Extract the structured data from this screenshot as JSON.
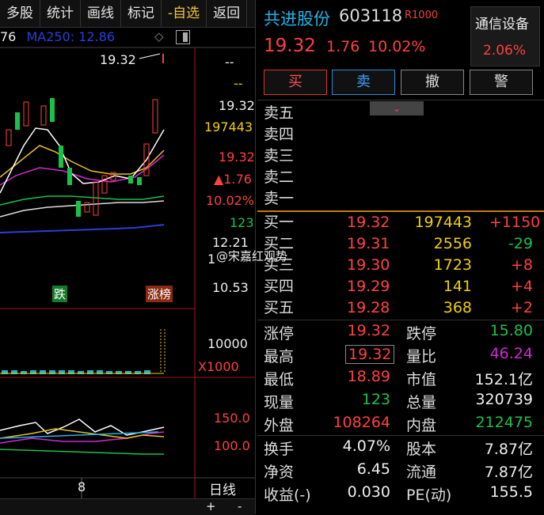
{
  "toolbar": {
    "items": [
      "多股",
      "统计",
      "画线",
      "标记",
      "-自选",
      "返回"
    ]
  },
  "chart": {
    "ma_prefix": "76",
    "ma250_label": "MA250: 12.86",
    "high_marker": "19.32",
    "price_axis": [
      "--",
      "--",
      "19.32",
      "197443",
      "19.32",
      "▲1.76",
      "10.02%",
      "123",
      "12.21",
      "1",
      "10.53"
    ],
    "tag_die": "跌",
    "tag_zhangbang": "涨榜",
    "vol_axis": [
      "10000",
      "X1000"
    ],
    "ind_axis": [
      "150.0",
      "100.0"
    ],
    "x_label": "8",
    "period": "日线",
    "plus": "+",
    "minus": "-"
  },
  "header": {
    "name": "共进股份",
    "code": "603118",
    "badge": "R1000",
    "last": "19.32",
    "change": "1.76",
    "change_pct": "10.02%",
    "industry": "通信设备",
    "industry_pct": "2.06%"
  },
  "actions": {
    "buy": "买",
    "sell": "卖",
    "cancel": "撤",
    "alert": "警"
  },
  "orderbook": {
    "asks": [
      "卖五",
      "卖四",
      "卖三",
      "卖二",
      "卖一"
    ],
    "bids": [
      {
        "label": "买一",
        "price": "19.32",
        "vol": "197443",
        "diff": "+1150"
      },
      {
        "label": "买二",
        "price": "19.31",
        "vol": "2556",
        "diff": "-29"
      },
      {
        "label": "买三",
        "price": "19.30",
        "vol": "1723",
        "diff": "+8"
      },
      {
        "label": "买四",
        "price": "19.29",
        "vol": "141",
        "diff": "+4"
      },
      {
        "label": "买五",
        "price": "19.28",
        "vol": "368",
        "diff": "+2"
      }
    ]
  },
  "stats": {
    "zt_lbl": "涨停",
    "zt_val": "19.32",
    "dt_lbl": "跌停",
    "dt_val": "15.80",
    "high_lbl": "最高",
    "high_val": "19.32",
    "lb_lbl": "量比",
    "lb_val": "46.24",
    "low_lbl": "最低",
    "low_val": "18.89",
    "mv_lbl": "市值",
    "mv_val": "152.1亿",
    "now_lbl": "现量",
    "now_val": "123",
    "tot_lbl": "总量",
    "tot_val": "320739",
    "out_lbl": "外盘",
    "out_val": "108264",
    "in_lbl": "内盘",
    "in_val": "212475",
    "hs_lbl": "换手",
    "hs_val": "4.07%",
    "gb_lbl": "股本",
    "gb_val": "7.87亿",
    "jz_lbl": "净资",
    "jz_val": "6.45",
    "lt_lbl": "流通",
    "lt_val": "7.87亿",
    "sy_lbl": "收益(-)",
    "sy_val": "0.030",
    "pe_lbl": "PE(动)",
    "pe_val": "155.5"
  },
  "watermark": "@宋嘉红观势",
  "colors": {
    "up": "#ff4040",
    "down": "#19c14a",
    "vol": "#f2d000",
    "link": "#22b5e8"
  }
}
